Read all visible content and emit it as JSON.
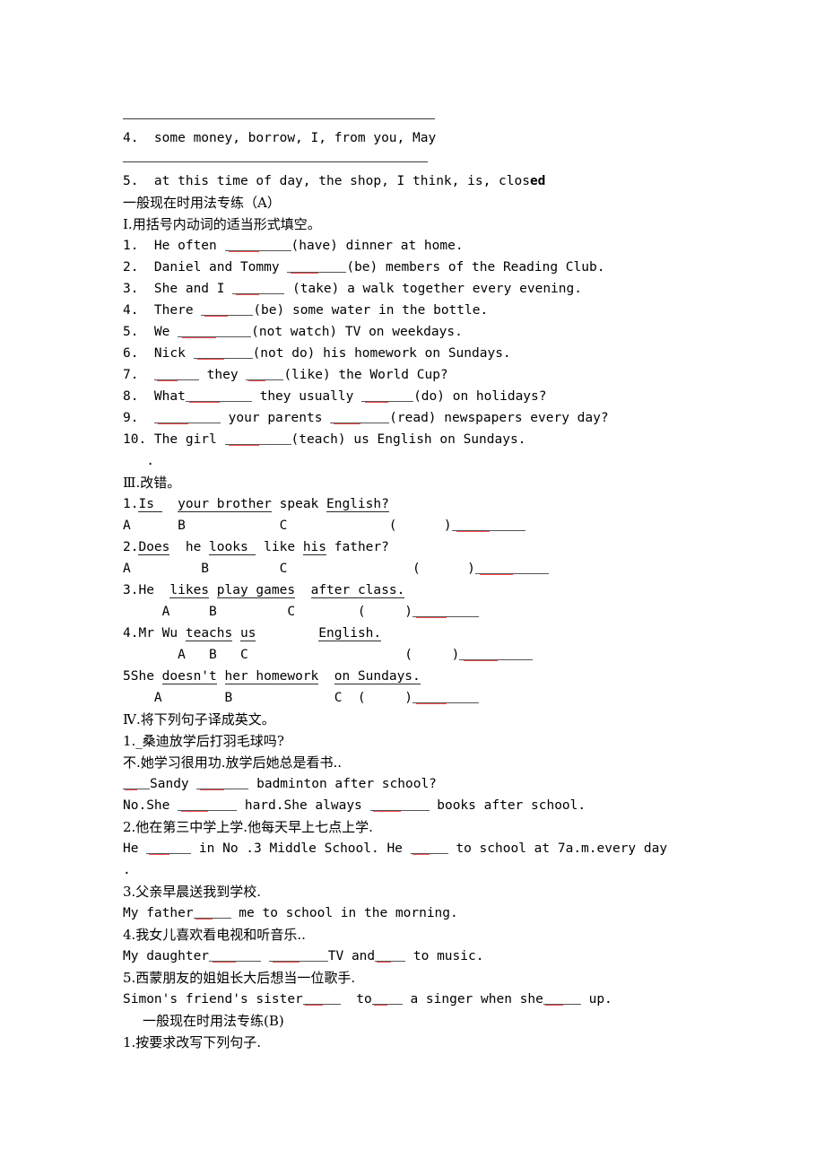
{
  "document": {
    "type": "english-grammar-worksheet",
    "language": "zh-CN",
    "top_items": {
      "item4": "4.  some money, borrow, I, from you, May",
      "item5_normal": "5.  at this time of day, the shop, I think, is, clos",
      "item5_bold": "ed"
    },
    "section_a": {
      "heading": "一般现在时用法专练（A）",
      "part1_heading": "Ⅰ.用括号内动词的适当形式填空。",
      "questions": [
        {
          "num": "1.",
          "pre": "  He often ",
          "blank": 74,
          "post": "(have) dinner at home."
        },
        {
          "num": "2.",
          "pre": "  Daniel and Tommy ",
          "blank": 66,
          "post": "(be) members of the Reading Club."
        },
        {
          "num": "3.",
          "pre": "  She and I ",
          "blank": 58,
          "post": " (take) a walk together every evening."
        },
        {
          "num": "4.",
          "pre": "  There ",
          "blank": 58,
          "post": "(be) some water in the bottle."
        },
        {
          "num": "5.",
          "pre": "  We ",
          "blank": 82,
          "post": "(not watch) TV on weekdays."
        },
        {
          "num": "6.",
          "pre": "  Nick ",
          "blank": 66,
          "post": "(not do) his homework on Sundays."
        },
        {
          "num": "7.",
          "pre": "  ",
          "blank": 50,
          "mid": " they ",
          "blank2": 42,
          "post": "(like) the World Cup?"
        },
        {
          "num": "8.",
          "pre": "  What",
          "blank": 74,
          "mid": " they usually ",
          "blank2": 58,
          "post": "(do) on holidays?"
        },
        {
          "num": "9.",
          "pre": "  ",
          "blank": 74,
          "mid": " your parents ",
          "blank2": 66,
          "post": "(read) newspapers every day?"
        },
        {
          "num": "10.",
          "pre": " The girl ",
          "blank": 74,
          "post": "(teach) us English on Sundays."
        }
      ],
      "stray_dot": "   .",
      "part3_heading": "Ⅲ.改错。",
      "corrections": [
        {
          "line": "1.",
          "segments": [
            {
              "text": "Is ",
              "underline": true
            },
            {
              "text": "  ",
              "underline": false
            },
            {
              "text": "your brother",
              "underline": true
            },
            {
              "text": " speak ",
              "underline": false
            },
            {
              "text": "English?",
              "underline": true
            }
          ],
          "markers": "A      B            C             (      )",
          "marker_indent": 0
        },
        {
          "line": "2.",
          "segments": [
            {
              "text": "Does",
              "underline": true
            },
            {
              "text": "  he ",
              "underline": false
            },
            {
              "text": "looks ",
              "underline": true
            },
            {
              "text": " like ",
              "underline": false
            },
            {
              "text": "his",
              "underline": true
            },
            {
              "text": " father?",
              "underline": false
            }
          ],
          "markers": "A         B         C                (      )",
          "marker_indent": 0
        },
        {
          "line": "3.",
          "segments": [
            {
              "text": "He  ",
              "underline": false
            },
            {
              "text": "likes",
              "underline": true
            },
            {
              "text": " ",
              "underline": false
            },
            {
              "text": "play games",
              "underline": true
            },
            {
              "text": "  ",
              "underline": false
            },
            {
              "text": "after class.",
              "underline": true
            }
          ],
          "markers": "     A     B         C        (     )",
          "marker_indent": 0
        },
        {
          "line": "4.",
          "segments": [
            {
              "text": "Mr Wu ",
              "underline": false
            },
            {
              "text": "teachs",
              "underline": true
            },
            {
              "text": " ",
              "underline": false
            },
            {
              "text": "us",
              "underline": true
            },
            {
              "text": "        ",
              "underline": false
            },
            {
              "text": "English.",
              "underline": true
            }
          ],
          "markers": "       A   B   C                    (     )",
          "marker_indent": 0
        },
        {
          "line": "5",
          "segments": [
            {
              "text": "She ",
              "underline": false
            },
            {
              "text": "doesn't",
              "underline": true
            },
            {
              "text": " ",
              "underline": false
            },
            {
              "text": "her homework",
              "underline": true
            },
            {
              "text": "  ",
              "underline": false
            },
            {
              "text": "on Sundays.",
              "underline": true
            }
          ],
          "markers": "    A        B             C  (     )",
          "marker_indent": 0
        }
      ],
      "part4_heading": "Ⅳ.将下列句子译成英文。",
      "translations": [
        {
          "cn": "1._桑迪放学后打羽毛球吗?"
        },
        {
          "cn": "不.她学习很用功.放学后她总是看书.."
        },
        {
          "en_pre": "",
          "blank_a": 30,
          "mid": "Sandy ",
          "blank_b": 58,
          "post": " badminton after school?"
        },
        {
          "en_pre": "No.She ",
          "blank_a": 66,
          "mid": " hard.She always ",
          "blank_b": 66,
          "post": " books after school."
        },
        {
          "cn": "2.他在第三中学上学.他每天早上七点上学."
        },
        {
          "en_pre": "He ",
          "blank_a": 50,
          "mid": " in No .3 Middle School. He ",
          "blank_b": 42,
          "post": " to school at 7a.m.every day"
        },
        {
          "cn2": "."
        },
        {
          "cn": "3.父亲早晨送我到学校."
        },
        {
          "en_pre": "My father",
          "blank_a": 42,
          "post2": " me to school in the morning."
        },
        {
          "cn": "4.我女儿喜欢看电视和听音乐.."
        },
        {
          "en_pre": "My daughter",
          "blank_a": 58,
          "mid": " ",
          "blank_b": 66,
          "post": "TV and",
          "blank_c": 34,
          "post3": " to music."
        },
        {
          "cn": "5.西蒙朋友的姐姐长大后想当一位歌手."
        },
        {
          "en_pre": "Simon's friend's sister",
          "blank_a": 42,
          "mid": "  to",
          "blank_b": 34,
          "post": " a singer when she",
          "blank_c": 42,
          "post3": " up."
        }
      ]
    },
    "section_b": {
      "heading": "一般现在时用法专练(B)",
      "part1_heading": "1.按要求改写下列句子."
    },
    "colors": {
      "text": "#000000",
      "rule": "#3a3a3a",
      "spellcheck_red": "#ff4d4d"
    }
  }
}
